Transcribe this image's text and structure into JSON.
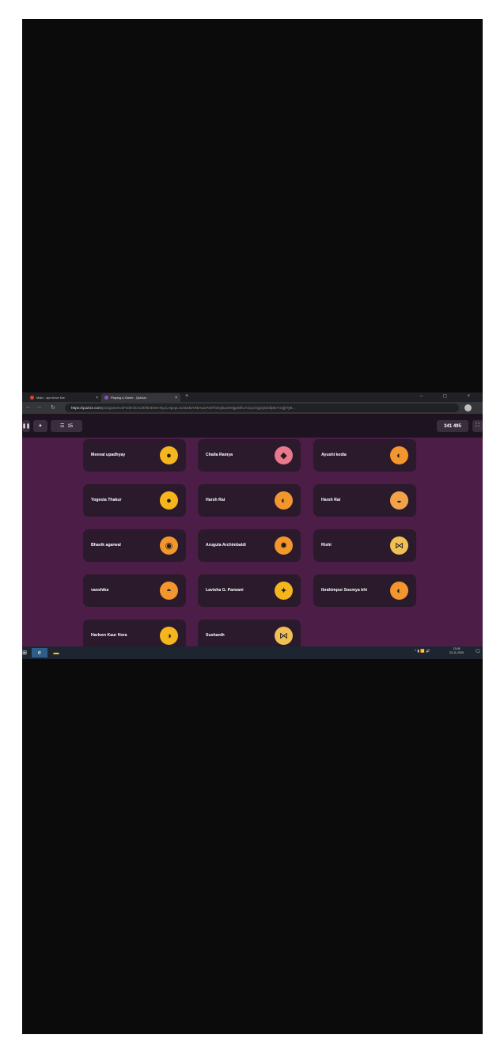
{
  "browser": {
    "tabs": [
      {
        "label": "Main - apo bove live",
        "icon": "dot-icon",
        "color": "#e0442e"
      },
      {
        "label": "Playing a Game - Quizizz",
        "icon": "quizizz-tab-icon",
        "color": "#8854c0"
      }
    ],
    "new_tab": "+",
    "window_controls": "– ◻ ×",
    "url_host": "https://quizizz.com",
    "url_path": "/join/game/U2FsdGVkX1/8rlhDEWvrNy1LHpzpLXcs53MARbAw1Pe8TbDQbaz8XlgpWfiUAGqV1Qj3yDDfpBVTxQjtTyB...",
    "nav": {
      "back": "←",
      "forward": "→",
      "reload": "↻",
      "lock": "🔒"
    }
  },
  "quizizz": {
    "topbar": {
      "pause_icon": "❚❚",
      "plane_icon": "✈",
      "players_icon": "☲",
      "player_count": "15",
      "join_code": "341 495",
      "fullscreen_icon": "⛶"
    },
    "players": [
      {
        "name": "Meenal upadhyay",
        "avatar": "popsicle-avatar",
        "color": "#f5b51d",
        "glyph": "●"
      },
      {
        "name": "Challa Ramya",
        "avatar": "cake-avatar",
        "color": "#e8788c",
        "glyph": "◆"
      },
      {
        "name": "Ayushi kedia",
        "avatar": "donut-avatar",
        "color": "#f2962d",
        "glyph": "◐"
      },
      {
        "name": "Yogesta Thakur",
        "avatar": "popsicle-avatar",
        "color": "#f5b51d",
        "glyph": "●"
      },
      {
        "name": "Harsh Rai",
        "avatar": "donut-avatar",
        "color": "#f2962d",
        "glyph": "◐"
      },
      {
        "name": "Harsh Rai",
        "avatar": "fish-avatar",
        "color": "#f3a24a",
        "glyph": "◒"
      },
      {
        "name": "Bhavik agarwal",
        "avatar": "burger-avatar",
        "color": "#f2962d",
        "glyph": "◉"
      },
      {
        "name": "Arugula Archimbaldi",
        "avatar": "bug-avatar",
        "color": "#f2962d",
        "glyph": "✹"
      },
      {
        "name": "Rishi",
        "avatar": "butterfly-avatar",
        "color": "#f0c056",
        "glyph": "⋈"
      },
      {
        "name": "vanshika",
        "avatar": "watermelon-avatar",
        "color": "#f2962d",
        "glyph": "◓"
      },
      {
        "name": "Lavisha G. Parwani",
        "avatar": "unicorn-avatar",
        "color": "#f5b51d",
        "glyph": "✦"
      },
      {
        "name": "Ibrahimpur Soumya bhi",
        "avatar": "donut-avatar",
        "color": "#f2962d",
        "glyph": "◐"
      },
      {
        "name": "Harleen Kaur Hora",
        "avatar": "planet-avatar",
        "color": "#f5b51d",
        "glyph": "◑"
      },
      {
        "name": "Sushanth",
        "avatar": "butterfly-avatar",
        "color": "#f0c056",
        "glyph": "⋈"
      }
    ]
  },
  "taskbar": {
    "start_icon": "⊞",
    "edge_icon": "e",
    "explorer_icon": "▬",
    "tray": "^ ▮ 📶 🔊",
    "time": "13:05",
    "date": "23-11-2020",
    "notif_icon": "🗨"
  },
  "colors": {
    "lobby_bg": "#4c1d47",
    "card_bg": "#2a1a2c",
    "topbar_bg": "#1e1320"
  }
}
